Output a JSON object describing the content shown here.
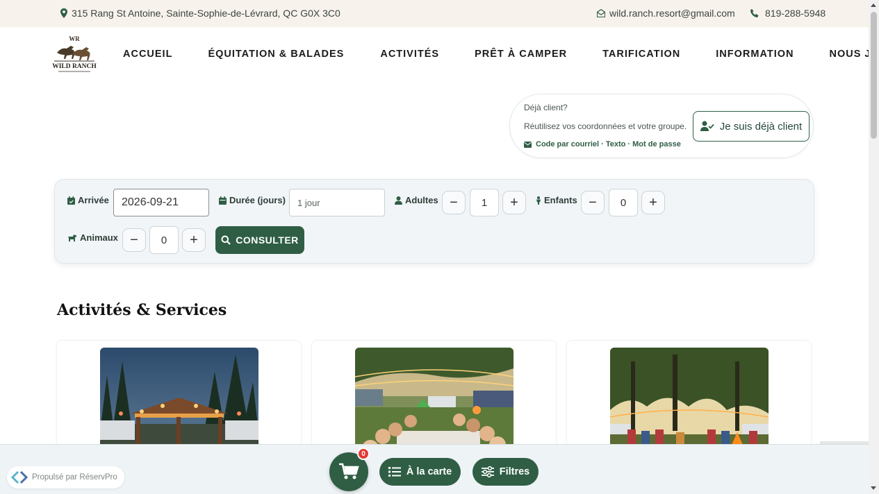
{
  "topbar": {
    "address": "315 Rang St Antoine, Sainte-Sophie-de-Lévrard, QC G0X 3C0",
    "email": "wild.ranch.resort@gmail.com",
    "phone": "819-288-5948"
  },
  "logo": {
    "text_top": "WR",
    "text_main": "WILD RANCH"
  },
  "nav": {
    "items": [
      "ACCUEIL",
      "ÉQUITATION & BALADES",
      "ACTIVITÉS",
      "PRÊT À CAMPER",
      "TARIFICATION",
      "INFORMATION",
      "NOUS JOINDRE"
    ]
  },
  "client": {
    "question": "Déjà client?",
    "description": "Réutilisez vos coordonnées et votre groupe.",
    "methods": "Code par courriel · Texto · Mot de passe",
    "button_label": "Je suis déjà client"
  },
  "search": {
    "arrival_label": "Arrivée",
    "arrival_value": "2026-09-21",
    "duration_label": "Durée (jours)",
    "duration_value": "1 jour",
    "adults_label": "Adultes",
    "adults_value": "1",
    "children_label": "Enfants",
    "children_value": "0",
    "pets_label": "Animaux",
    "pets_value": "0",
    "minus": "−",
    "plus": "+",
    "consult_label": "CONSULTER"
  },
  "section": {
    "title": "Activités & Services"
  },
  "bottombar": {
    "powered_by": "Propulsé par RéservPro",
    "cart_count": "0",
    "a_la_carte_label": "À la carte",
    "filters_label": "Filtres"
  },
  "colors": {
    "brand_green": "#2f5e45",
    "topbar_bg": "#f8f2ec",
    "badge_red": "#e53935"
  }
}
